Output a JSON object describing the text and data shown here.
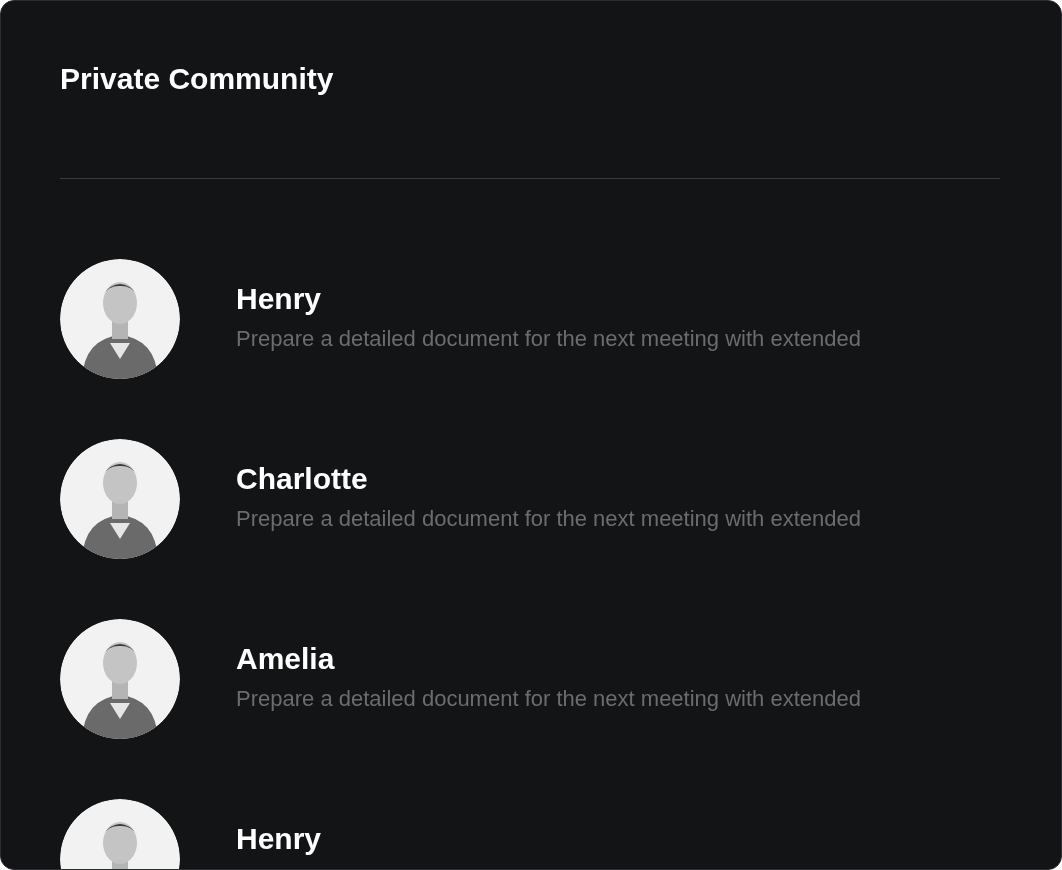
{
  "title": "Private Community",
  "members": [
    {
      "name": "Henry",
      "message": "Prepare a detailed document for the next meeting with extended"
    },
    {
      "name": "Charlotte",
      "message": "Prepare a detailed document for the next meeting with extended"
    },
    {
      "name": "Amelia",
      "message": "Prepare a detailed document for the next meeting with extended"
    },
    {
      "name": "Henry"
    }
  ]
}
